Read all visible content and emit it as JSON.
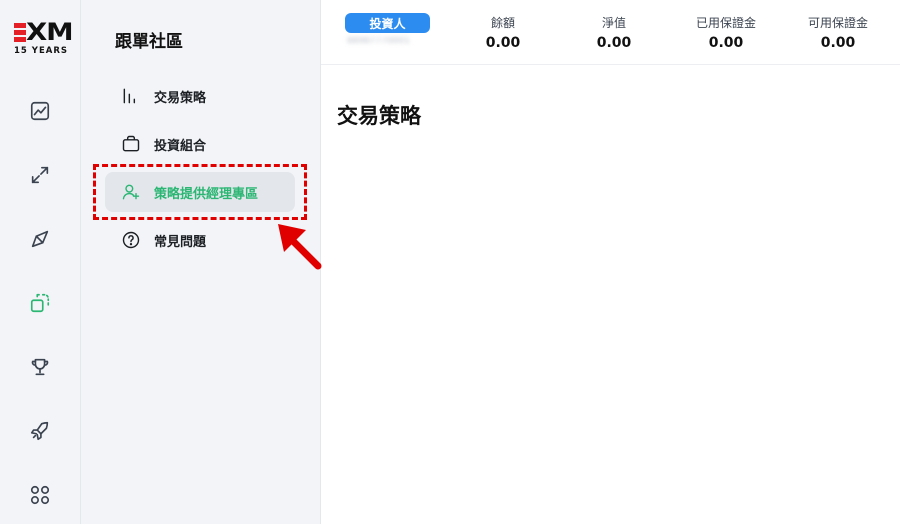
{
  "brand": {
    "logo_text": "XM",
    "logo_sub": "15 YEARS",
    "accent": "#2bb673",
    "badge_color": "#2d8cf0",
    "annotation_color": "#e00000"
  },
  "rail": {
    "icons": [
      "chart-icon",
      "transfer-arrows-icon",
      "compass-icon",
      "copy-trading-icon",
      "trophy-icon",
      "rocket-icon",
      "apps-grid-icon"
    ],
    "active_index": 3
  },
  "sidebar": {
    "title": "跟單社區",
    "items": [
      {
        "label": "交易策略",
        "icon": "bar-chart-icon",
        "active": false
      },
      {
        "label": "投資組合",
        "icon": "briefcase-icon",
        "active": false
      },
      {
        "label": "策略提供經理專區",
        "icon": "user-plus-icon",
        "active": true
      },
      {
        "label": "常見問題",
        "icon": "question-circle-icon",
        "active": false
      }
    ]
  },
  "topbar": {
    "account_type": "投資人",
    "account_id": "88987770001",
    "stats": [
      {
        "label": "餘額",
        "value": "0.00"
      },
      {
        "label": "淨值",
        "value": "0.00"
      },
      {
        "label": "已用保證金",
        "value": "0.00"
      },
      {
        "label": "可用保證金",
        "value": "0.00"
      }
    ]
  },
  "main": {
    "title": "交易策略"
  }
}
